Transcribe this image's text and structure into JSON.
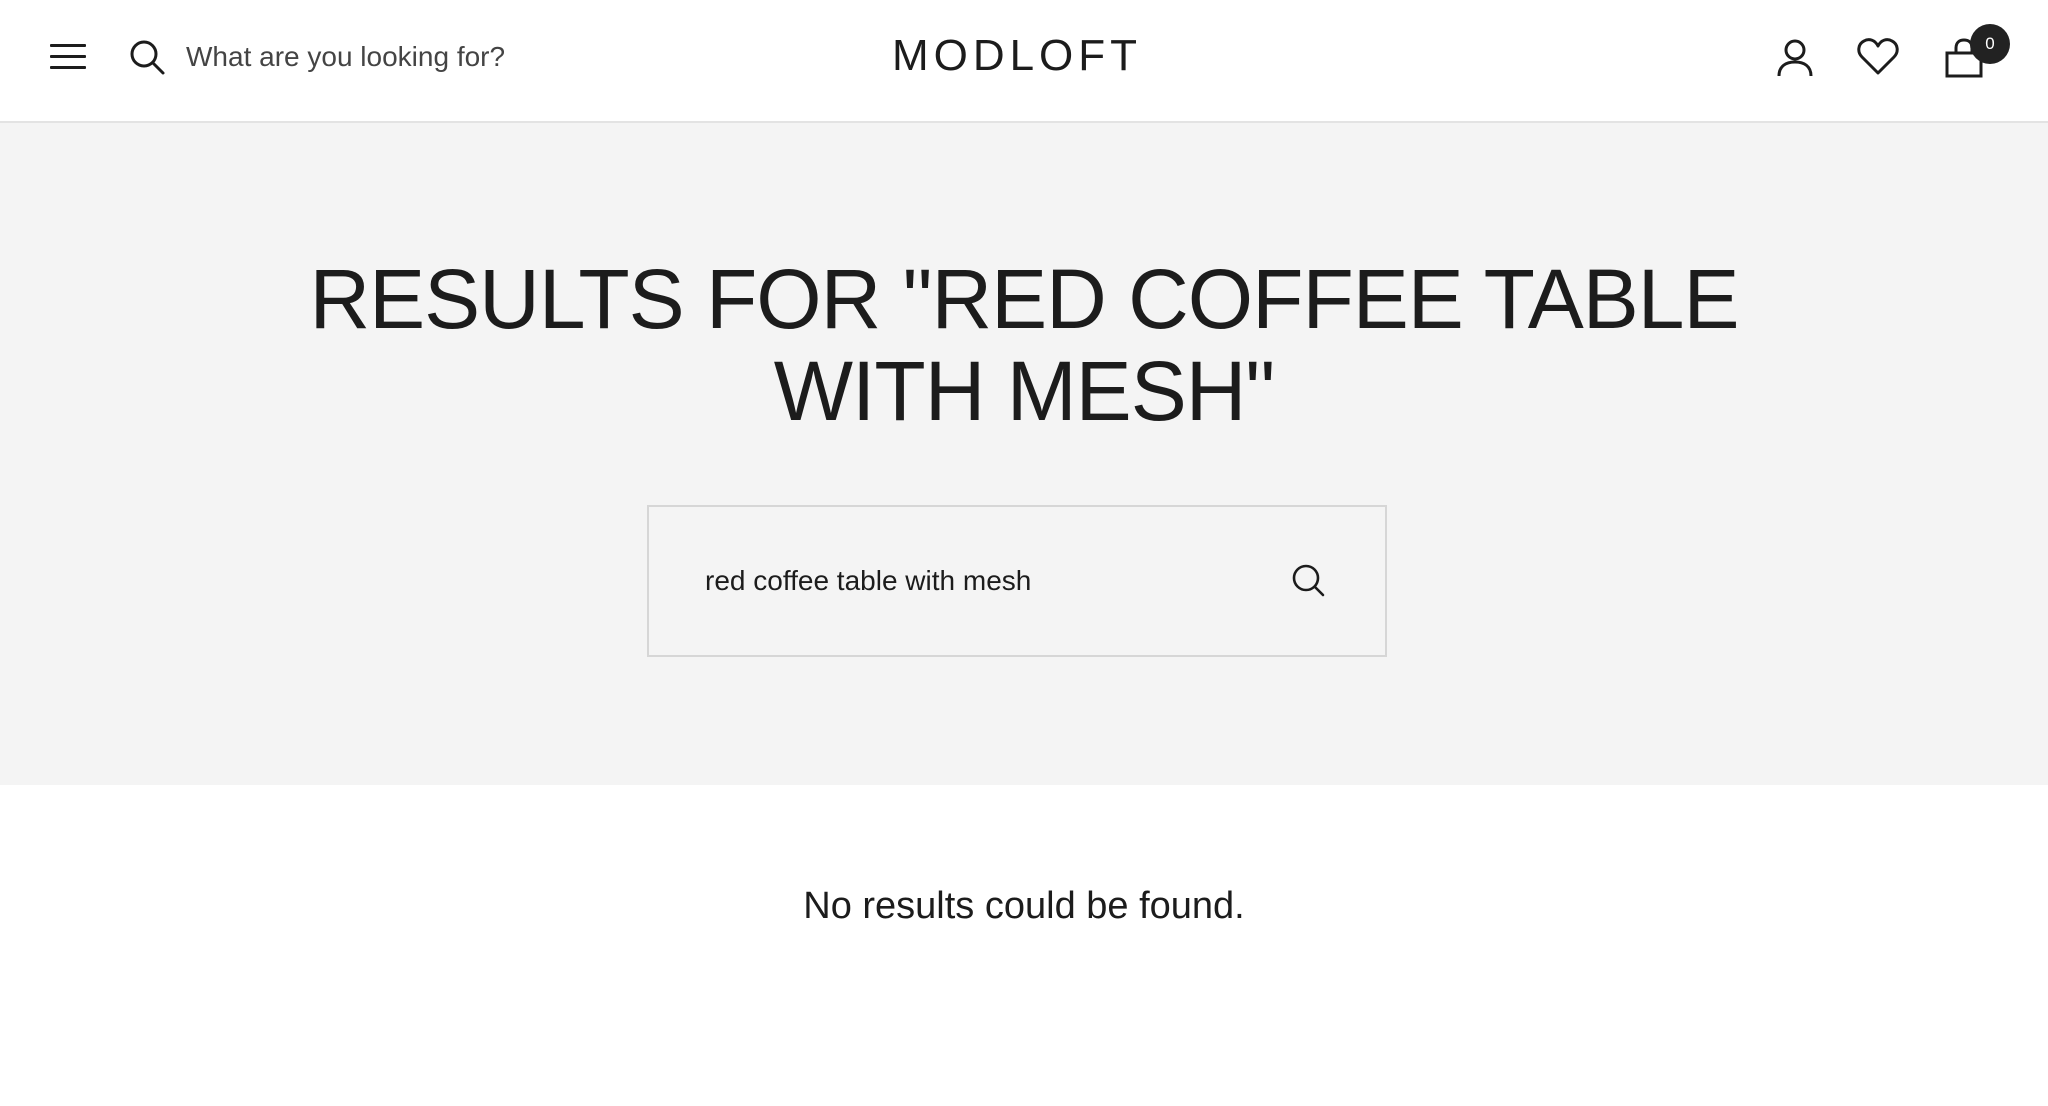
{
  "header": {
    "search_placeholder": "What are you looking for?",
    "logo_text": "MODLOFT",
    "cart_count": "0",
    "icons": {
      "menu": "hamburger-menu-icon",
      "search": "search-icon",
      "account": "user-icon",
      "wishlist": "heart-icon",
      "cart": "shopping-bag-icon"
    }
  },
  "hero": {
    "title": "RESULTS FOR \"RED COFFEE TABLE WITH MESH\"",
    "search_value": "red coffee table with mesh",
    "background_color": "#f4f4f4"
  },
  "results": {
    "message": "No results could be found."
  }
}
